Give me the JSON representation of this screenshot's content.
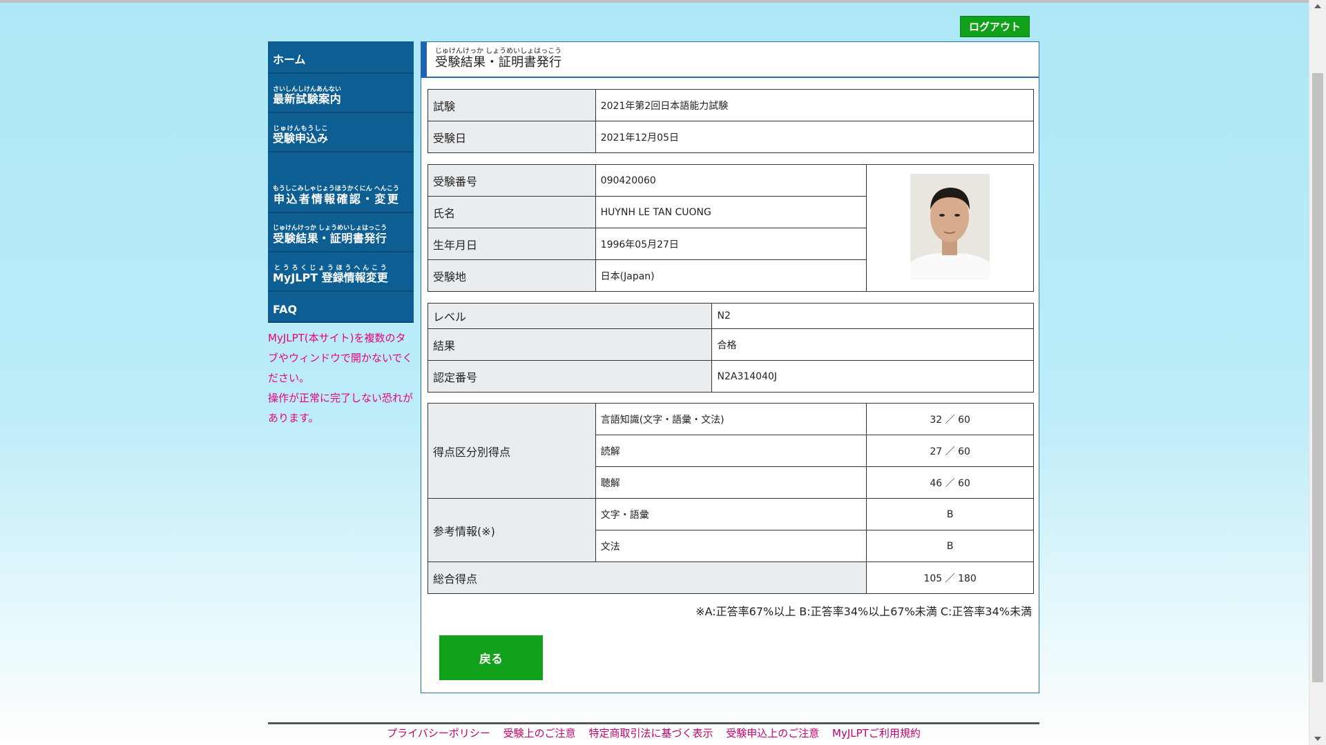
{
  "header": {
    "logout_label": "ログアウト"
  },
  "sidebar": {
    "items": [
      {
        "label": "ホーム",
        "ruby": ""
      },
      {
        "label": "最新試験案内",
        "ruby": "さいしんしけんあんない"
      },
      {
        "label": "受験申込み",
        "ruby": "じゅけんもうしこ"
      },
      {
        "label": "申込者情報確認・変更",
        "ruby": "もうしこみしゃじょうほうかくにん へんこう"
      },
      {
        "label": "受験結果・証明書発行",
        "ruby": "じゅけんけっか しょうめいしょはっこう"
      },
      {
        "label": "MyJLPT 登録情報変更",
        "ruby": "とうろくじょうほうへんこう"
      },
      {
        "label": "FAQ",
        "ruby": ""
      }
    ],
    "notice_line1": "MyJLPT(本サイト)を複数のタブやウィンドウで開かないでください。",
    "notice_line2": "操作が正常に完了しない恐れがあります。"
  },
  "panel": {
    "title": "受験結果・証明書発行",
    "title_ruby": "じゅけんけっか しょうめいしょはっこう"
  },
  "exam": {
    "exam_label": "試験",
    "exam_value": "2021年第2回日本語能力試験",
    "date_label": "受験日",
    "date_value": "2021年12月05日"
  },
  "examinee": {
    "number_label": "受験番号",
    "number_value": "090420060",
    "name_label": "氏名",
    "name_value": "HUYNH LE TAN CUONG",
    "dob_label": "生年月日",
    "dob_value": "1996年05月27日",
    "site_label": "受験地",
    "site_value": "日本(Japan)"
  },
  "result": {
    "level_label": "レベル",
    "level_value": "N2",
    "result_label": "結果",
    "result_value": "合格",
    "cert_label": "認定番号",
    "cert_value": "N2A314040J"
  },
  "scores": {
    "section_label": "得点区分別得点",
    "section1_name": "言語知識(文字・語彙・文法)",
    "section1_score": "32 ／ 60",
    "section2_name": "読解",
    "section2_score": "27 ／ 60",
    "section3_name": "聴解",
    "section3_score": "46 ／ 60",
    "reference_label": "参考情報(※)",
    "ref1_name": "文字・語彙",
    "ref1_grade": "B",
    "ref2_name": "文法",
    "ref2_grade": "B",
    "total_label": "総合得点",
    "total_score": "105 ／ 180"
  },
  "legend": "※A:正答率67%以上 B:正答率34%以上67%未満 C:正答率34%未満",
  "back_label": "戻る",
  "footer": {
    "links": [
      "プライバシーポリシー",
      "受験上のご注意",
      "特定商取引法に基づく表示",
      "受験申込上のご注意",
      "MyJLPTご利用規約"
    ]
  },
  "colors": {
    "nav_bg": "#0c5e93",
    "button_green": "#11a11a",
    "notice_pink": "#e6007e",
    "header_cell": "#e9edf0"
  }
}
